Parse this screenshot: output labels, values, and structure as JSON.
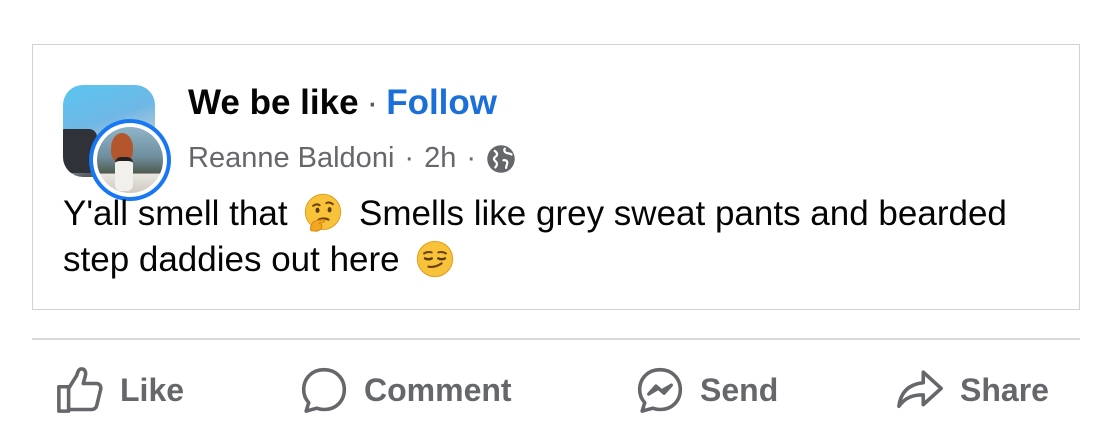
{
  "post": {
    "group_name": "We be like",
    "separator": "·",
    "follow_label": "Follow",
    "author": "Reanne Baldoni",
    "time": "2h",
    "meta_separator": "·",
    "privacy_icon": "globe-icon",
    "text_part1": "Y'all smell that",
    "emoji1": "thinking-face-emoji",
    "text_part2": "Smells like grey sweat pants and bearded step daddies out here",
    "emoji2": "smirking-face-emoji"
  },
  "actions": {
    "like_label": "Like",
    "comment_label": "Comment",
    "send_label": "Send",
    "share_label": "Share"
  },
  "colors": {
    "accent": "#1b6fd8",
    "secondary_text": "#65676b",
    "avatar_ring": "#1877f2"
  }
}
